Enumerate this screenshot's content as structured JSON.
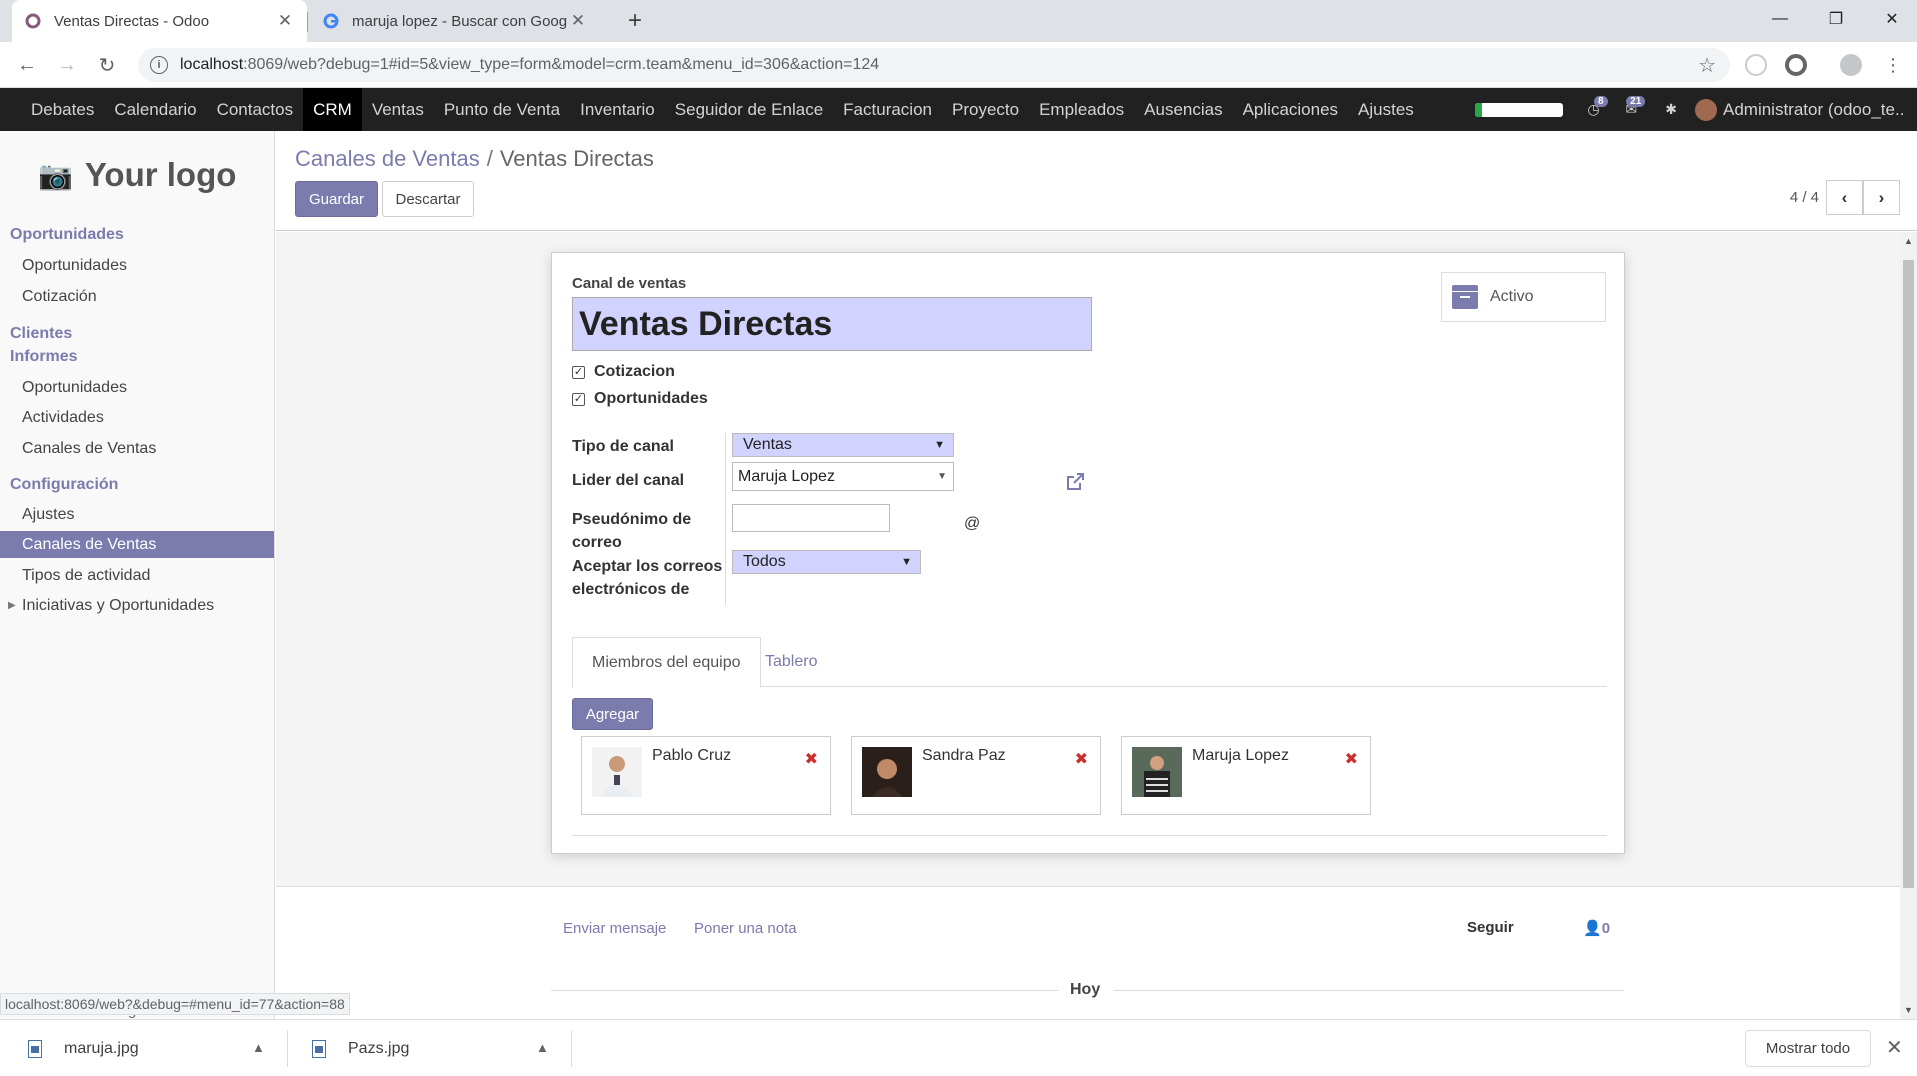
{
  "browser": {
    "tabs": [
      {
        "title": "Ventas Directas - Odoo",
        "active": true
      },
      {
        "title": "maruja lopez - Buscar con Google",
        "active": false
      }
    ],
    "url_host": "localhost",
    "url_rest": ":8069/web?debug=1#id=5&view_type=form&model=crm.team&menu_id=306&action=124",
    "status_url": "localhost:8069/web?&debug=#menu_id=77&action=88"
  },
  "topnav": {
    "items": [
      "Debates",
      "Calendario",
      "Contactos",
      "CRM",
      "Ventas",
      "Punto de Venta",
      "Inventario",
      "Seguidor de Enlace",
      "Facturacion",
      "Proyecto",
      "Empleados",
      "Ausencias",
      "Aplicaciones",
      "Ajustes"
    ],
    "active": "CRM",
    "progress": 0.08,
    "badge_activities": "8",
    "badge_messages": "21",
    "user": "Administrator (odoo_te..."
  },
  "sidebar": {
    "logo_text": "Your logo",
    "sections": [
      {
        "label": "Oportunidades",
        "items": [
          "Oportunidades",
          "Cotización"
        ]
      },
      {
        "label": "Clientes",
        "items": []
      },
      {
        "label": "Informes",
        "items": [
          "Oportunidades",
          "Actividades",
          "Canales de Ventas"
        ]
      },
      {
        "label": "Configuración",
        "items": [
          "Ajustes",
          "Canales de Ventas",
          "Tipos de actividad",
          "Iniciativas y Oportunidades"
        ]
      }
    ],
    "selected": "Canales de Ventas",
    "powered": "Con tecnología de Odoo"
  },
  "control": {
    "breadcrumb_parent": "Canales de Ventas",
    "breadcrumb_sep": "/",
    "breadcrumb_current": "Ventas Directas",
    "save_label": "Guardar",
    "discard_label": "Descartar",
    "pager": "4 / 4"
  },
  "form": {
    "name_label": "Canal de ventas",
    "name_value": "Ventas Directas",
    "archive_label": "Activo",
    "checkboxes": [
      {
        "label": "Cotizacion",
        "checked": true
      },
      {
        "label": "Oportunidades",
        "checked": true
      }
    ],
    "fields": {
      "tipo_label": "Tipo de canal",
      "tipo_value": "Ventas",
      "lider_label": "Lider del canal",
      "lider_value": "Maruja Lopez",
      "alias_label_1": "Pseudónimo de",
      "alias_label_2": "correo",
      "alias_value": "",
      "alias_suffix": "@",
      "accept_label_1": "Aceptar los correos",
      "accept_label_2": "electrónicos de",
      "accept_value": "Todos"
    },
    "tabs": [
      "Miembros del equipo",
      "Tablero"
    ],
    "add_label": "Agregar",
    "members": [
      "Pablo Cruz",
      "Sandra Paz",
      "Maruja Lopez"
    ]
  },
  "chatter": {
    "send_message": "Enviar mensaje",
    "log_note": "Poner una nota",
    "follow": "Seguir",
    "followers_count": "0",
    "today": "Hoy"
  },
  "downloads": {
    "files": [
      "maruja.jpg",
      "Pazs.jpg"
    ],
    "show_all": "Mostrar todo"
  },
  "colors": {
    "primary": "#7c7bad",
    "navbar": "#212121",
    "input_required": "#d2d2ff"
  }
}
